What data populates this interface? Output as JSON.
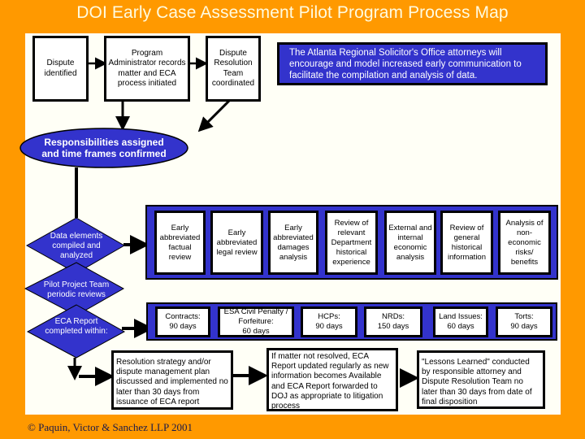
{
  "title": "DOI Early Case Assessment Pilot Program Process Map",
  "colors": {
    "background": "#ff9900",
    "panel": "#fffff6",
    "shape_blue": "#3333cc",
    "title_text": "#fffbe0"
  },
  "top_row": {
    "dispute_identified": "Dispute identified",
    "program_administrator": "Program Administrator records matter and ECA process initiated",
    "dispute_resolution_team": "Dispute Resolution Team coordinated",
    "note": "The Atlanta Regional Solicitor's Office attorneys will encourage and model increased early communication to facilitate the compilation and analysis of data."
  },
  "ellipse": {
    "label": "Responsibilities assigned and time frames confirmed"
  },
  "diamonds": {
    "data_elements": "Data elements compiled and analyzed",
    "pilot_review": "Pilot Project Team periodic reviews",
    "eca_report": "ECA Report completed within:"
  },
  "analysis_boxes": [
    "Early abbreviated factual review",
    "Early abbreviated legal review",
    "Early abbreviated damages analysis",
    "Review of relevant Department historical experience",
    "External and internal economic analysis",
    "Review of general historical information",
    "Analysis of non-economic risks/ benefits"
  ],
  "timeframes": [
    {
      "category": "Contracts:",
      "days": "90 days"
    },
    {
      "category": "ESA Civil Penalty / Forfeiture:",
      "days": "60 days"
    },
    {
      "category": "HCPs:",
      "days": "90 days"
    },
    {
      "category": "NRDs:",
      "days": "150 days"
    },
    {
      "category": "Land Issues:",
      "days": "60 days"
    },
    {
      "category": "Torts:",
      "days": "90 days"
    }
  ],
  "bottom_row": {
    "resolution_strategy": "Resolution strategy and/or dispute management plan discussed and implemented no later than 30 days from issuance of ECA report",
    "eca_update": "If matter not resolved, ECA Report updated regularly as new information becomes Available and ECA Report forwarded to DOJ as appropriate to litigation process",
    "lessons_learned": "\"Lessons Learned\" conducted by responsible attorney and Dispute Resolution Team no later than 30 days from date of final disposition"
  },
  "footer": {
    "symbol": "©",
    "text": "Paquin, Victor & Sanchez LLP 2001"
  }
}
